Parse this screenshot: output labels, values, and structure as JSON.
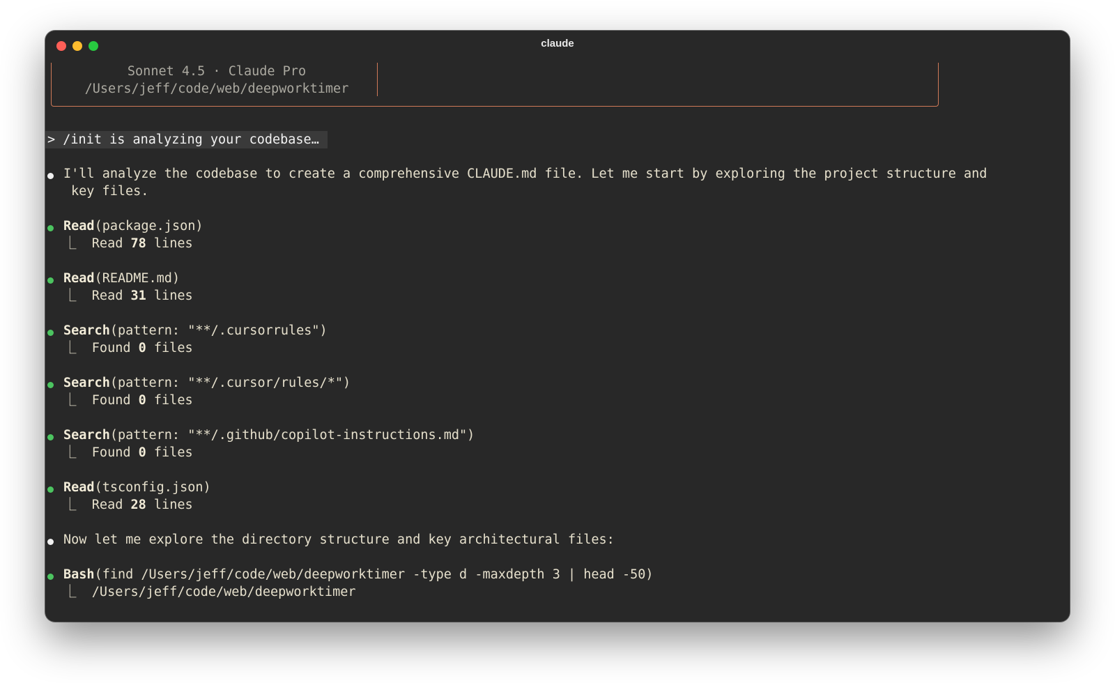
{
  "window": {
    "title": "claude"
  },
  "header": {
    "model": "Sonnet 4.5 · Claude Pro",
    "path": "/Users/jeff/code/web/deepworktimer"
  },
  "prompt": {
    "text": "> /init is analyzing your codebase…"
  },
  "messages": [
    {
      "type": "text",
      "line1": "I'll analyze the codebase to create a comprehensive CLAUDE.md file. Let me start by exploring the project structure and",
      "line2": "key files."
    },
    {
      "type": "tool",
      "tool": "Read",
      "args": "(package.json)",
      "result_prefix": "Read ",
      "result_count": "78",
      "result_suffix": " lines"
    },
    {
      "type": "tool",
      "tool": "Read",
      "args": "(README.md)",
      "result_prefix": "Read ",
      "result_count": "31",
      "result_suffix": " lines"
    },
    {
      "type": "tool",
      "tool": "Search",
      "args": "(pattern: \"**/.cursorrules\")",
      "result_prefix": "Found ",
      "result_count": "0",
      "result_suffix": " files"
    },
    {
      "type": "tool",
      "tool": "Search",
      "args": "(pattern: \"**/.cursor/rules/*\")",
      "result_prefix": "Found ",
      "result_count": "0",
      "result_suffix": " files"
    },
    {
      "type": "tool",
      "tool": "Search",
      "args": "(pattern: \"**/.github/copilot-instructions.md\")",
      "result_prefix": "Found ",
      "result_count": "0",
      "result_suffix": " files"
    },
    {
      "type": "tool",
      "tool": "Read",
      "args": "(tsconfig.json)",
      "result_prefix": "Read ",
      "result_count": "28",
      "result_suffix": " lines"
    },
    {
      "type": "text",
      "line1": "Now let me explore the directory structure and key architectural files:"
    },
    {
      "type": "tool",
      "tool": "Bash",
      "args": "(find /Users/jeff/code/web/deepworktimer -type d -maxdepth 3 | head -50)",
      "result_prefix": "/Users/jeff/code/web/deepworktimer",
      "result_count": "",
      "result_suffix": ""
    }
  ],
  "colors": {
    "background": "#282828",
    "accent_border": "#d07a58",
    "tool_bullet": "#4cc460",
    "text_bullet": "#f0f0f0",
    "text": "#e6e0cc"
  },
  "icons": {
    "result_elbow": "⎿"
  }
}
